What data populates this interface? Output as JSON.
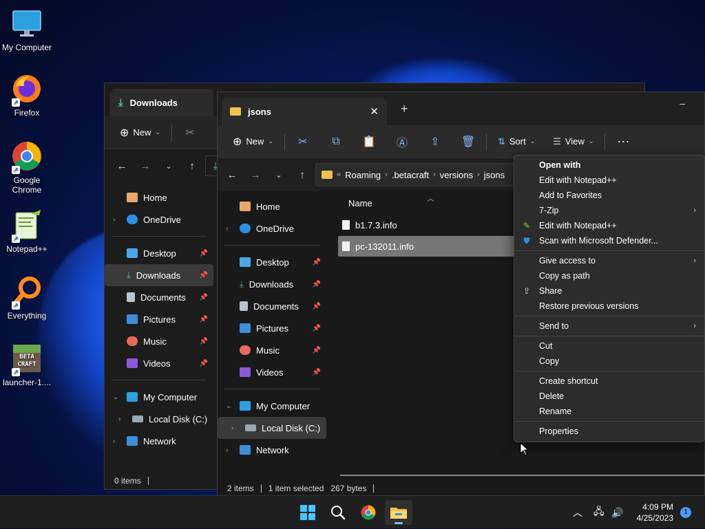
{
  "desktop": {
    "icons": [
      {
        "label": "My Computer"
      },
      {
        "label": "Firefox"
      },
      {
        "label": "Google Chrome"
      },
      {
        "label": "Notepad++"
      },
      {
        "label": "Everything"
      },
      {
        "label": "launcher-1...."
      }
    ]
  },
  "back_window": {
    "tab_title": "Downloads",
    "new_label": "New",
    "sidebar": {
      "home": "Home",
      "onedrive": "OneDrive",
      "desktop": "Desktop",
      "downloads": "Downloads",
      "documents": "Documents",
      "pictures": "Pictures",
      "music": "Music",
      "videos": "Videos",
      "my_computer": "My Computer",
      "local_disk": "Local Disk (C:)",
      "network": "Network"
    },
    "status": "0 items"
  },
  "front_window": {
    "tab_title": "jsons",
    "toolbar": {
      "new": "New",
      "sort": "Sort",
      "view": "View"
    },
    "breadcrumb": {
      "sep": "«",
      "parts": [
        "Roaming",
        ".betacraft",
        "versions",
        "jsons"
      ]
    },
    "column_name": "Name",
    "files": [
      "b1.7.3.info",
      "pc-132011.info"
    ],
    "sidebar": {
      "home": "Home",
      "onedrive": "OneDrive",
      "desktop": "Desktop",
      "downloads": "Downloads",
      "documents": "Documents",
      "pictures": "Pictures",
      "music": "Music",
      "videos": "Videos",
      "my_computer": "My Computer",
      "local_disk": "Local Disk (C:)",
      "network": "Network"
    },
    "status": {
      "items": "2 items",
      "selected": "1 item selected",
      "size": "267 bytes"
    }
  },
  "context_menu": {
    "open_with": "Open with",
    "edit_notepad_1": "Edit with Notepad++",
    "add_favorites": "Add to Favorites",
    "seven_zip": "7-Zip",
    "edit_notepad_2": "Edit with Notepad++",
    "scan_defender": "Scan with Microsoft Defender...",
    "give_access": "Give access to",
    "copy_path": "Copy as path",
    "share": "Share",
    "restore": "Restore previous versions",
    "send_to": "Send to",
    "cut": "Cut",
    "copy": "Copy",
    "create_shortcut": "Create shortcut",
    "delete": "Delete",
    "rename": "Rename",
    "properties": "Properties"
  },
  "taskbar": {
    "time": "4:09 PM",
    "date": "4/25/2023",
    "notification_count": "1"
  }
}
